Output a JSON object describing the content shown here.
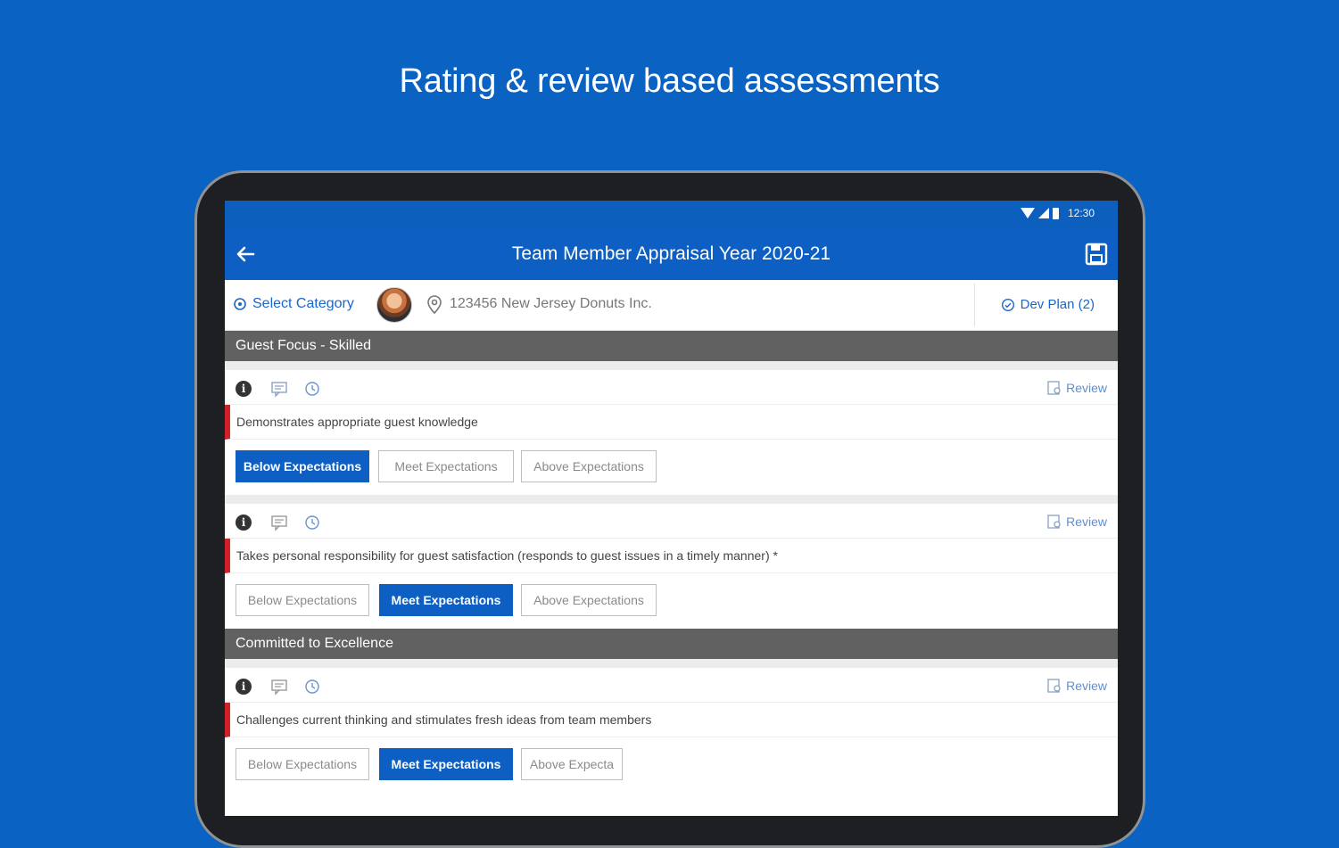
{
  "headline": "Rating & review based assessments",
  "status_bar": {
    "time": "12:30"
  },
  "app_bar": {
    "title": "Team Member Appraisal Year 2020-21"
  },
  "filter_bar": {
    "select_category": "Select Category",
    "location": "123456 New Jersey Donuts Inc.",
    "dev_plan": "Dev Plan (2)"
  },
  "review_label": "Review",
  "sections": [
    {
      "title": "Guest Focus - Skilled",
      "items": [
        {
          "text": "Demonstrates appropriate guest knowledge",
          "ratings": [
            "Below Expectations",
            "Meet Expectations",
            "Above Expectations"
          ],
          "selected": 0
        },
        {
          "text": "Takes personal responsibility for guest satisfaction (responds to guest issues in a timely manner) *",
          "ratings": [
            "Below Expectations",
            "Meet Expectations",
            "Above Expectations"
          ],
          "selected": 1
        }
      ]
    },
    {
      "title": "Committed to Excellence",
      "items": [
        {
          "text": "Challenges current thinking and stimulates fresh ideas from team members",
          "ratings": [
            "Below Expectations",
            "Meet Expectations",
            "Above Expecta"
          ],
          "selected": 1
        }
      ]
    }
  ],
  "colors": {
    "background": "#0a62c2",
    "primary": "#0d5fc4",
    "accent_bar": "#d02028",
    "section_header": "#616161"
  }
}
